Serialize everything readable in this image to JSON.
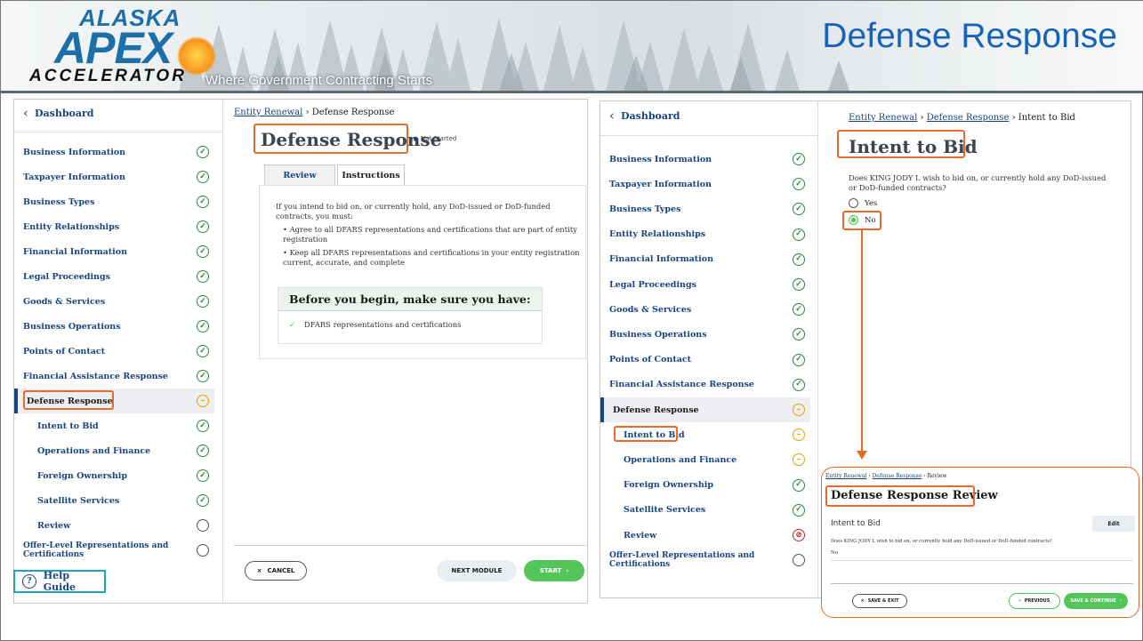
{
  "header": {
    "logo_top": "ALASKA",
    "logo_main": "APEX",
    "logo_bottom": "ACCELERATOR",
    "tagline": "Where Government Contracting Starts",
    "slide_title": "Defense Response"
  },
  "left": {
    "dashboard": "Dashboard",
    "sidebar": [
      {
        "label": "Business Information",
        "status": "complete"
      },
      {
        "label": "Taxpayer Information",
        "status": "complete"
      },
      {
        "label": "Business Types",
        "status": "complete"
      },
      {
        "label": "Entity Relationships",
        "status": "complete"
      },
      {
        "label": "Financial Information",
        "status": "complete"
      },
      {
        "label": "Legal Proceedings",
        "status": "complete"
      },
      {
        "label": "Goods & Services",
        "status": "complete"
      },
      {
        "label": "Business Operations",
        "status": "complete"
      },
      {
        "label": "Points of Contact",
        "status": "complete"
      },
      {
        "label": "Financial Assistance Response",
        "status": "complete"
      },
      {
        "label": "Defense Response",
        "status": "in-progress"
      },
      {
        "label": "Intent to Bid",
        "status": "complete"
      },
      {
        "label": "Operations and Finance",
        "status": "complete"
      },
      {
        "label": "Foreign Ownership",
        "status": "complete"
      },
      {
        "label": "Satellite Services",
        "status": "complete"
      },
      {
        "label": "Review",
        "status": "not-started"
      },
      {
        "label": "Offer-Level Representations and Certifications",
        "status": "not-started"
      }
    ],
    "help_label": "Help Guide",
    "help_icon": "?",
    "breadcrumb_link": "Entity Renewal",
    "breadcrumb_current": "Defense Response",
    "page_title": "Defense Response",
    "status_badge": "Not Started",
    "tab_review": "Review",
    "tab_instructions": "Instructions",
    "instructions_intro": "If you intend to bid on, or currently hold, any DoD-issued or DoD-funded contracts, you must:",
    "bullet_1": "Agree to all DFARS representations and certifications that are part of entity registration",
    "bullet_2": "Keep all DFARS representations and certifications in your entity registration current, accurate, and complete",
    "before_heading": "Before you begin, make sure you have:",
    "before_item": "DFARS representations and certifications",
    "cancel_label": "CANCEL",
    "next_label": "NEXT MODULE",
    "start_label": "START"
  },
  "right": {
    "dashboard": "Dashboard",
    "sidebar": [
      {
        "label": "Business Information",
        "status": "complete"
      },
      {
        "label": "Taxpayer Information",
        "status": "complete"
      },
      {
        "label": "Business Types",
        "status": "complete"
      },
      {
        "label": "Entity Relationships",
        "status": "complete"
      },
      {
        "label": "Financial Information",
        "status": "complete"
      },
      {
        "label": "Legal Proceedings",
        "status": "complete"
      },
      {
        "label": "Goods & Services",
        "status": "complete"
      },
      {
        "label": "Business Operations",
        "status": "complete"
      },
      {
        "label": "Points of Contact",
        "status": "complete"
      },
      {
        "label": "Financial Assistance Response",
        "status": "complete"
      },
      {
        "label": "Defense Response",
        "status": "in-progress"
      },
      {
        "label": "Intent to Bid",
        "status": "in-progress"
      },
      {
        "label": "Operations and Finance",
        "status": "in-progress"
      },
      {
        "label": "Foreign Ownership",
        "status": "complete"
      },
      {
        "label": "Satellite Services",
        "status": "complete"
      },
      {
        "label": "Review",
        "status": "error"
      },
      {
        "label": "Offer-Level Representations and Certifications",
        "status": "not-started"
      }
    ],
    "breadcrumb_link_1": "Entity Renewal",
    "breadcrumb_link_2": "Defense Response",
    "breadcrumb_current": "Intent to Bid",
    "page_title": "Intent to Bid",
    "question": "Does KING JODY L wish to bid on, or currently hold any DoD-issued or DoD-funded contracts?",
    "option_yes": "Yes",
    "option_no": "No",
    "selected_option": "No"
  },
  "review": {
    "breadcrumb_link_1": "Entity Renewal",
    "breadcrumb_link_2": "Defense Response",
    "breadcrumb_current": "Review",
    "title": "Defense Response Review",
    "section": "Intent to Bid",
    "edit_label": "Edit",
    "question": "Does KING JODY L wish to bid on, or currently hold any DoD-issued or DoD-funded contracts?",
    "answer": "No",
    "save_exit_label": "SAVE & EXIT",
    "previous_label": "PREVIOUS",
    "save_continue_label": "SAVE & CONTINUE"
  },
  "colors": {
    "accent": "#1a4480",
    "highlight": "#e66a2c",
    "complete": "#2e8540",
    "in_progress": "#e5a000",
    "error": "#c0282f",
    "title_blue": "#1663b7"
  }
}
